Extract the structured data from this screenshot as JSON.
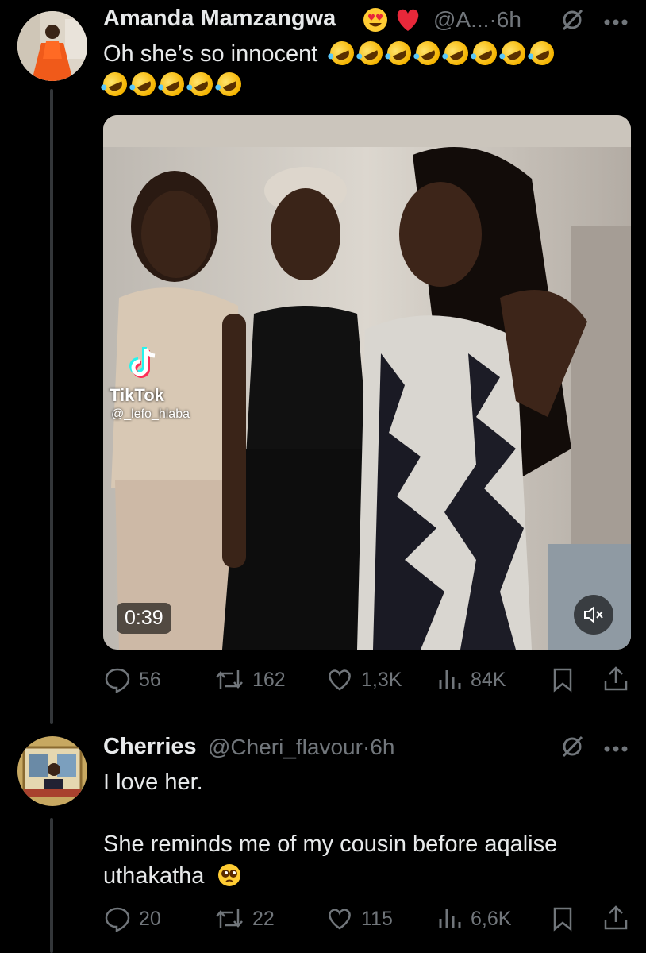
{
  "tweet1": {
    "author_name": "Amanda Mamzangwa",
    "name_emojis": [
      "smiling-face-heart-eyes",
      "red-heart"
    ],
    "handle_time": "@A...·6h",
    "text_line1": "Oh she’s so innocent",
    "emoji_line1": [
      "rofl",
      "rofl",
      "rofl",
      "rofl",
      "rofl",
      "rofl",
      "rofl",
      "rofl"
    ],
    "emoji_line2": [
      "rofl",
      "rofl",
      "rofl",
      "rofl",
      "rofl"
    ],
    "video": {
      "watermark_brand": "TikTok",
      "watermark_handle": "@_lefo_hlaba",
      "duration": "0:39",
      "mute_icon": "speaker-muted-icon"
    },
    "stats": {
      "replies": "56",
      "reposts": "162",
      "likes": "1,3K",
      "views": "84K"
    }
  },
  "tweet2": {
    "author_name": "Cherries",
    "handle_time": "@Cheri_flavour·6h",
    "text_line1": "I love her.",
    "text_line2": "She reminds me of my cousin before aqalise",
    "text_line3": "uthakatha",
    "text_emoji": "pleading-face",
    "stats": {
      "replies": "20",
      "reposts": "22",
      "likes": "115",
      "views": "6,6K"
    }
  },
  "colors": {
    "background": "#000000",
    "text_primary": "#e7e9ea",
    "text_secondary": "#71767b",
    "thread_line": "#333639"
  }
}
